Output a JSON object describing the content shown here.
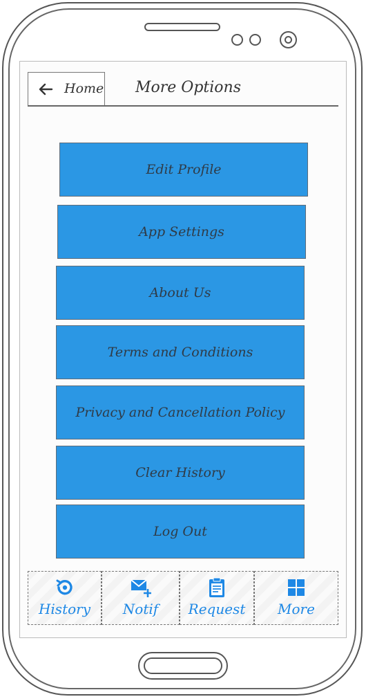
{
  "header": {
    "back_label": "Home",
    "title": "More Options"
  },
  "menu": {
    "items": [
      {
        "label": "Edit Profile"
      },
      {
        "label": "App Settings"
      },
      {
        "label": "About Us"
      },
      {
        "label": "Terms and Conditions"
      },
      {
        "label": "Privacy and Cancellation Policy"
      },
      {
        "label": "Clear History"
      },
      {
        "label": "Log Out"
      }
    ]
  },
  "tabs": [
    {
      "label": "History",
      "icon": "history-icon"
    },
    {
      "label": "Notif",
      "icon": "mail-plus-icon"
    },
    {
      "label": "Request",
      "icon": "clipboard-icon"
    },
    {
      "label": "More",
      "icon": "grid-icon"
    }
  ],
  "colors": {
    "button_fill": "#2b97e4",
    "tab_accent": "#1e88e5",
    "text_dark": "#333333"
  }
}
